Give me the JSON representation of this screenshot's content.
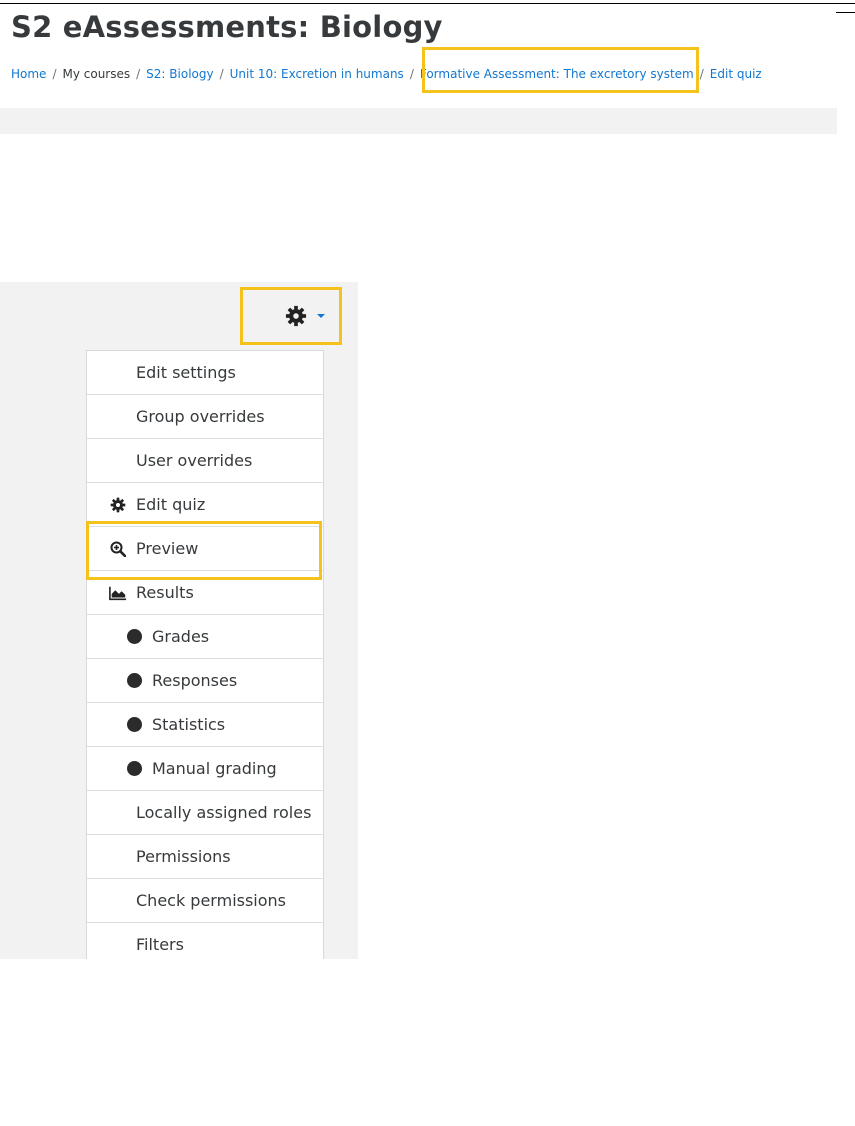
{
  "header": {
    "title": "S2 eAssessments: Biology"
  },
  "breadcrumb": {
    "items": [
      {
        "label": "Home",
        "link": true
      },
      {
        "label": "My courses",
        "link": false
      },
      {
        "label": "S2: Biology",
        "link": true
      },
      {
        "label": "Unit 10: Excretion in humans",
        "link": true
      },
      {
        "label": "Formative Assessment: The excretory system",
        "link": true
      },
      {
        "label": "Edit quiz",
        "link": true
      }
    ],
    "separator": "/"
  },
  "actions": {
    "gear_icon": "gear-icon",
    "caret_icon": "caret-down-icon"
  },
  "menu": {
    "items": [
      {
        "label": "Edit settings",
        "icon": null
      },
      {
        "label": "Group overrides",
        "icon": null
      },
      {
        "label": "User overrides",
        "icon": null
      },
      {
        "label": "Edit quiz",
        "icon": "gear-icon"
      },
      {
        "label": "Preview",
        "icon": "magnify-icon"
      },
      {
        "label": "Results",
        "icon": "area-chart-icon"
      },
      {
        "label": "Grades",
        "icon": "bullet-icon"
      },
      {
        "label": "Responses",
        "icon": "bullet-icon"
      },
      {
        "label": "Statistics",
        "icon": "bullet-icon"
      },
      {
        "label": "Manual grading",
        "icon": "bullet-icon"
      },
      {
        "label": "Locally assigned roles",
        "icon": null
      },
      {
        "label": "Permissions",
        "icon": null
      },
      {
        "label": "Check permissions",
        "icon": null
      },
      {
        "label": "Filters",
        "icon": null
      }
    ]
  },
  "colors": {
    "link": "#1177d1",
    "highlight": "#f4c21b",
    "text": "#373a3c",
    "panel_bg": "#f2f2f2"
  }
}
